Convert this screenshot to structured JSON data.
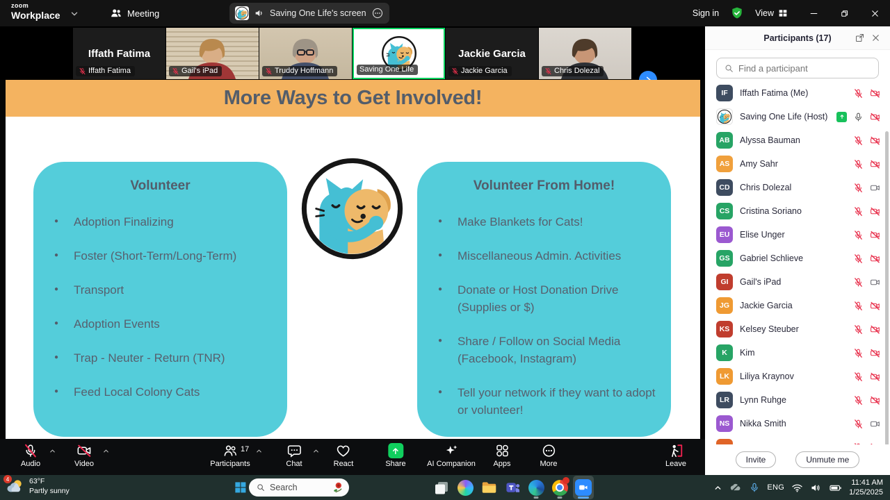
{
  "titlebar": {
    "logo_top": "zoom",
    "logo_bottom": "Workplace",
    "meeting_tab": "Meeting",
    "share_pill_text": "Saving One Life's screen",
    "sign_in_label": "Sign in",
    "view_label": "View"
  },
  "video_strip": {
    "tiles": [
      {
        "name": "Iffath Fatima",
        "kind": "name",
        "muted": true
      },
      {
        "name": "Gail's iPad",
        "kind": "video",
        "variant": "blinds",
        "muted": true
      },
      {
        "name": "Truddy Hoffmann",
        "kind": "video",
        "variant": "beige",
        "muted": true
      },
      {
        "name": "Saving One Life",
        "kind": "logo",
        "active": true,
        "muted": false
      },
      {
        "name": "Jackie Garcia",
        "kind": "name",
        "muted": true
      },
      {
        "name": "Chris Dolezal",
        "kind": "video",
        "variant": "bright",
        "muted": true
      }
    ]
  },
  "slide": {
    "title": "More Ways to Get Involved!",
    "colors": {
      "header_bg": "#f4b360",
      "box_bg": "#54cdda",
      "title_text": "#535d6b",
      "body_text": "#57606e"
    },
    "left_box": {
      "title": "Volunteer",
      "bullets": [
        "Adoption Finalizing",
        "Foster (Short-Term/Long-Term)",
        "Transport",
        "Adoption Events",
        "Trap - Neuter - Return (TNR)",
        "Feed Local Colony Cats"
      ]
    },
    "right_box": {
      "title": "Volunteer From Home!",
      "bullets": [
        "Make Blankets for Cats!",
        "Miscellaneous Admin. Activities",
        "Donate or Host Donation Drive (Supplies or $)",
        "Share / Follow on Social Media (Facebook, Instagram)",
        "Tell your network if they want to adopt or volunteer!"
      ]
    }
  },
  "participants_panel": {
    "title": "Participants (17)",
    "search_placeholder": "Find a participant",
    "invite_label": "Invite",
    "unmute_label": "Unmute me",
    "rows": [
      {
        "initials": "IF",
        "color": "#3e4c60",
        "name": "Iffath Fatima (Me)",
        "mic": "muted",
        "video": "off"
      },
      {
        "initials": "",
        "logo": true,
        "color": "#ffffff",
        "name": "Saving One Life (Host)",
        "sharing": true,
        "mic": "on",
        "video": "off"
      },
      {
        "initials": "AB",
        "color": "#27a465",
        "name": "Alyssa Bauman",
        "mic": "muted",
        "video": "off"
      },
      {
        "initials": "AS",
        "color": "#f0a03c",
        "name": "Amy Sahr",
        "mic": "muted",
        "video": "off"
      },
      {
        "initials": "CD",
        "color": "#3e4c60",
        "name": "Chris Dolezal",
        "mic": "muted",
        "video": "on"
      },
      {
        "initials": "CS",
        "color": "#27a465",
        "name": "Cristina Soriano",
        "mic": "muted",
        "video": "off"
      },
      {
        "initials": "EU",
        "color": "#9b59d0",
        "name": "Elise Unger",
        "mic": "muted",
        "video": "off"
      },
      {
        "initials": "GS",
        "color": "#27a465",
        "name": "Gabriel Schlieve",
        "mic": "muted",
        "video": "off"
      },
      {
        "initials": "GI",
        "color": "#c03d2e",
        "name": "Gail's iPad",
        "mic": "muted",
        "video": "on"
      },
      {
        "initials": "JG",
        "color": "#ef9a33",
        "name": "Jackie Garcia",
        "mic": "muted",
        "video": "off"
      },
      {
        "initials": "KS",
        "color": "#c03d2e",
        "name": "Kelsey Steuber",
        "mic": "muted",
        "video": "off"
      },
      {
        "initials": "K",
        "color": "#27a465",
        "name": "Kim",
        "mic": "muted",
        "video": "off"
      },
      {
        "initials": "LK",
        "color": "#ef9a33",
        "name": "Liliya Kraynov",
        "mic": "muted",
        "video": "off"
      },
      {
        "initials": "LR",
        "color": "#3e4c60",
        "name": "Lynn Ruhge",
        "mic": "muted",
        "video": "off"
      },
      {
        "initials": "NS",
        "color": "#9b59d0",
        "name": "Nikka Smith",
        "mic": "muted",
        "video": "on"
      },
      {
        "initials": "",
        "color": "#e06427",
        "name": "",
        "partial": true,
        "mic": "muted",
        "video": "off"
      }
    ]
  },
  "toolbar": {
    "items": [
      {
        "label": "Audio",
        "icon": "mic-muted",
        "caret": true
      },
      {
        "label": "Video",
        "icon": "video-muted",
        "caret": true
      },
      {
        "label": "Participants",
        "icon": "participants",
        "badge": "17",
        "caret": true
      },
      {
        "label": "Chat",
        "icon": "chat",
        "caret": true
      },
      {
        "label": "React",
        "icon": "react"
      },
      {
        "label": "Share",
        "icon": "share"
      },
      {
        "label": "AI Companion",
        "icon": "ai"
      },
      {
        "label": "Apps",
        "icon": "apps"
      },
      {
        "label": "More",
        "icon": "more"
      },
      {
        "label": "Leave",
        "icon": "leave"
      }
    ]
  },
  "taskbar": {
    "notification_count": "4",
    "weather_temp": "63°F",
    "weather_condition": "Partly sunny",
    "search_placeholder": "Search",
    "apps": [
      {
        "name": "task-view"
      },
      {
        "name": "copilot"
      },
      {
        "name": "file-explorer"
      },
      {
        "name": "teams"
      },
      {
        "name": "edge",
        "open": true
      },
      {
        "name": "chrome",
        "open": true,
        "badge": true
      },
      {
        "name": "zoom",
        "active": true
      }
    ],
    "language": "ENG",
    "time": "11:41 AM",
    "date": "1/25/2025"
  }
}
